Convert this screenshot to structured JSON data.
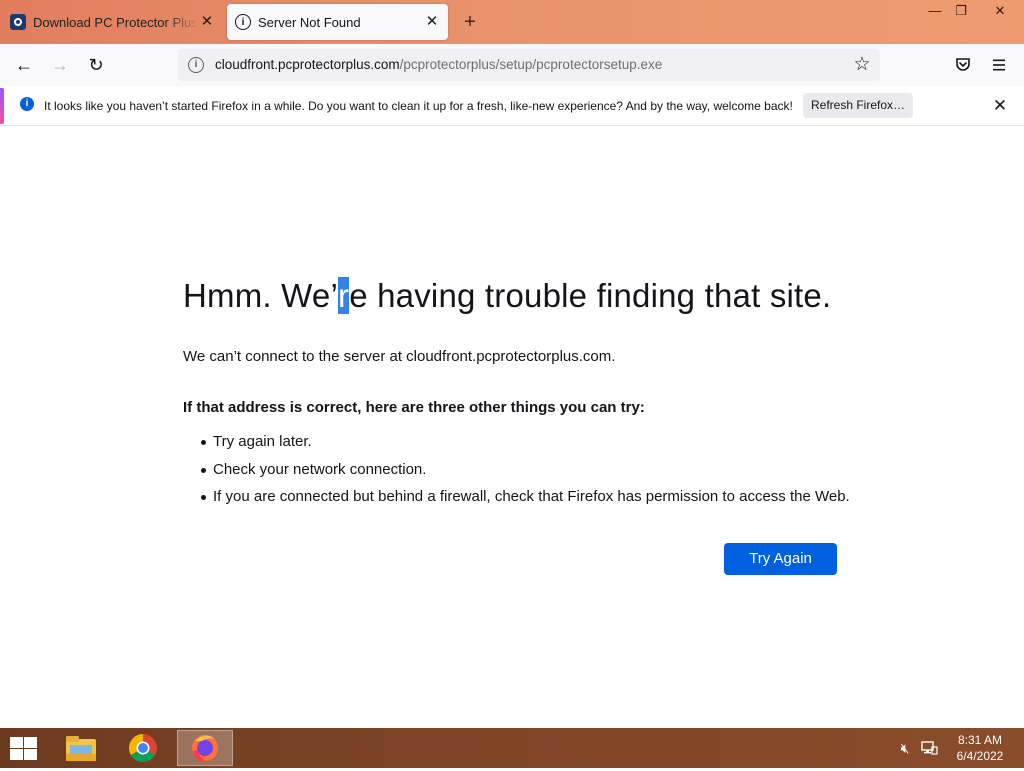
{
  "tabs": [
    {
      "title": "Download PC Protector Plus by",
      "favicon": "pc-protector-icon",
      "active": false
    },
    {
      "title": "Server Not Found",
      "favicon": "info-icon",
      "active": true
    }
  ],
  "window_controls": {
    "minimize": "—",
    "restore": "❐",
    "close": "✕"
  },
  "nav": {
    "back_icon": "←",
    "forward_icon": "→",
    "reload_icon": "↻",
    "url_host": "cloudfront.pcprotectorplus.com",
    "url_path": "/pcprotectorplus/setup/pcprotectorsetup.exe",
    "star_icon": "☆"
  },
  "notification": {
    "text": "It looks like you haven’t started Firefox in a while. Do you want to clean it up for a fresh, like-new experience? And by the way, welcome back!",
    "button_label": "Refresh Firefox…",
    "close_icon": "✕"
  },
  "error_page": {
    "title_before": "Hmm. We’",
    "title_selected": "r",
    "title_after": "e having trouble finding that site.",
    "description": "We can’t connect to the server at cloudfront.pcprotectorplus.com.",
    "suggestions_heading": "If that address is correct, here are three other things you can try:",
    "suggestions": [
      "Try again later.",
      "Check your network connection.",
      "If you are connected but behind a firewall, check that Firefox has permission to access the Web."
    ],
    "try_again_label": "Try Again"
  },
  "taskbar": {
    "apps": [
      "file-explorer",
      "chrome",
      "firefox"
    ],
    "active_app": "firefox",
    "time": "8:31 AM",
    "date": "6/4/2022"
  },
  "colors": {
    "tab_strip": "#e8916b",
    "accent_blue": "#0060df",
    "selection": "#3584e4",
    "taskbar": "#7e4526"
  }
}
